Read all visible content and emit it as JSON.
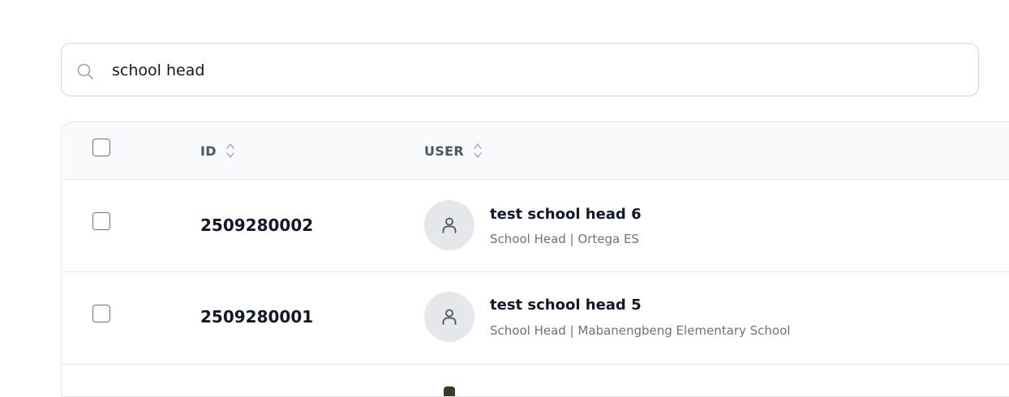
{
  "search": {
    "value": "school head",
    "icon": "search-icon"
  },
  "table": {
    "columns": [
      {
        "label": "ID",
        "sortable": true
      },
      {
        "label": "USER",
        "sortable": true
      }
    ],
    "rows": [
      {
        "id": "2509280002",
        "name": "test school head 6",
        "subtitle": "School Head | Ortega ES",
        "avatar_icon": "user-icon"
      },
      {
        "id": "2509280001",
        "name": "test school head 5",
        "subtitle": "School Head | Mabanengbeng Elementary School",
        "avatar_icon": "user-icon"
      }
    ]
  },
  "colors": {
    "border": "#d1d5db",
    "header_bg": "#f9fafb",
    "avatar_bg": "#e5e7eb",
    "muted_text": "#6b7280"
  }
}
